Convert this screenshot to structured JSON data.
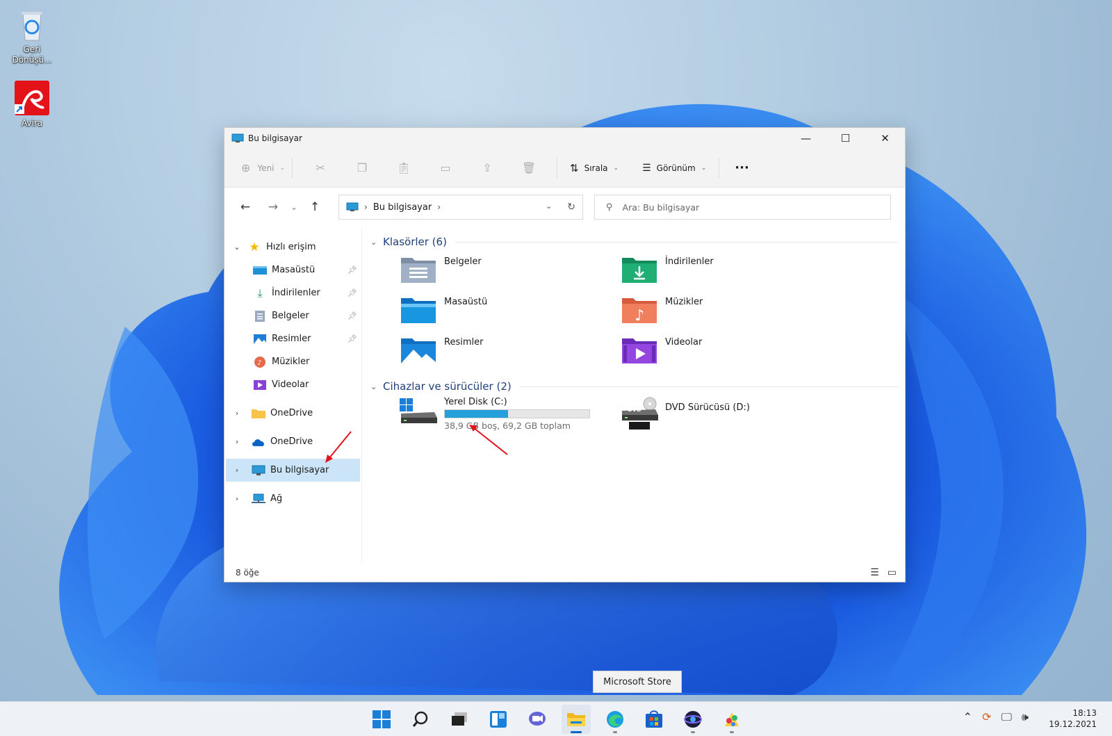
{
  "desktop": {
    "icons": [
      {
        "label": "Geri Dönüşü...",
        "icon": "recycle-bin-icon"
      },
      {
        "label": "Avira",
        "icon": "avira-icon"
      }
    ]
  },
  "window": {
    "title": "Bu bilgisayar",
    "controls": {
      "minimize": "—",
      "maximize": "☐",
      "close": "✕"
    }
  },
  "commandbar": {
    "new_label": "Yeni",
    "sort_label": "Sırala",
    "view_label": "Görünüm",
    "more_label": "···"
  },
  "address": {
    "crumb": "Bu bilgisayar",
    "search_placeholder": "Ara: Bu bilgisayar"
  },
  "nav": {
    "quick_access": "Hızlı erişim",
    "quick_items": [
      "Masaüstü",
      "İndirilenler",
      "Belgeler",
      "Resimler",
      "Müzikler",
      "Videolar"
    ],
    "onedrive1": "OneDrive",
    "onedrive2": "OneDrive",
    "this_pc": "Bu bilgisayar",
    "network": "Ağ"
  },
  "content": {
    "folders_header": "Klasörler (6)",
    "folders": [
      "Belgeler",
      "İndirilenler",
      "Masaüstü",
      "Müzikler",
      "Resimler",
      "Videolar"
    ],
    "devices_header": "Cihazlar ve sürücüler (2)",
    "drive_c": {
      "name": "Yerel Disk (C:)",
      "free_text": "38,9 GB boş, 69,2 GB toplam",
      "used_fraction": 0.438
    },
    "drive_d": {
      "name": "DVD Sürücüsü (D:)",
      "badge": "DVD"
    }
  },
  "status": {
    "items": "8 öğe"
  },
  "tooltip": "Microsoft Store",
  "clock": {
    "time": "18:13",
    "date": "19.12.2021"
  },
  "colors": {
    "accent": "#0067c0",
    "selection": "#cce4f7",
    "header": "#1f3f7a",
    "progress": "#26a0da",
    "arrow": "#e0141a"
  }
}
